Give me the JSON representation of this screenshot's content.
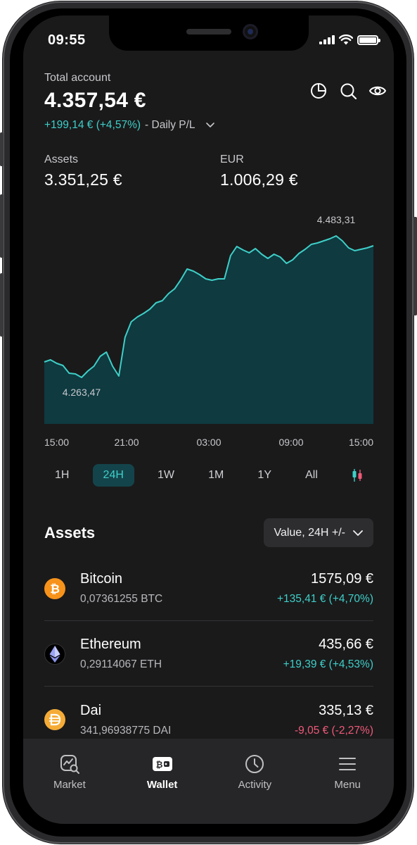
{
  "status_bar": {
    "time": "09:55"
  },
  "header": {
    "total_label": "Total account",
    "total_value": "4.357,54 €",
    "pl_change": "+199,14 € (+4,57%)",
    "pl_label": "- Daily P/L",
    "icons": [
      "pie-chart-icon",
      "search-icon",
      "eye-icon"
    ]
  },
  "balances": [
    {
      "label": "Assets",
      "value": "3.351,25 €"
    },
    {
      "label": "EUR",
      "value": "1.006,29 €"
    }
  ],
  "chart_data": {
    "type": "area",
    "title": "",
    "xlabel": "",
    "ylabel": "",
    "x_ticks": [
      "15:00",
      "21:00",
      "03:00",
      "09:00",
      "15:00"
    ],
    "high_label": "4.483,31",
    "low_label": "4.263,47",
    "ylim": [
      4210,
      4500
    ],
    "values": [
      4298,
      4301,
      4296,
      4293,
      4282,
      4281,
      4276,
      4285,
      4292,
      4306,
      4312,
      4292,
      4278,
      4333,
      4355,
      4362,
      4367,
      4373,
      4382,
      4385,
      4395,
      4402,
      4415,
      4430,
      4427,
      4422,
      4416,
      4414,
      4416,
      4416,
      4449,
      4462,
      4457,
      4453,
      4459,
      4451,
      4445,
      4451,
      4447,
      4438,
      4443,
      4452,
      4458,
      4465,
      4467,
      4470,
      4473,
      4477,
      4470,
      4460,
      4456,
      4458,
      4460,
      4463
    ],
    "grid": false,
    "legend": "none",
    "colors": {
      "line": "#3ecfc8",
      "fill": "#0e3a40"
    }
  },
  "timeframes": {
    "items": [
      "1H",
      "24H",
      "1W",
      "1M",
      "1Y",
      "All"
    ],
    "active": "24H"
  },
  "assets_section": {
    "title": "Assets",
    "sort_label": "Value, 24H +/-",
    "items": [
      {
        "name": "Bitcoin",
        "amount": "0,07361255 BTC",
        "value": "1575,09 €",
        "change": "+135,41 € (+4,70%)",
        "direction": "up",
        "icon": "bitcoin-icon",
        "color": "#f7931a"
      },
      {
        "name": "Ethereum",
        "amount": "0,29114067 ETH",
        "value": "435,66 €",
        "change": "+19,39 € (+4,53%)",
        "direction": "up",
        "icon": "ethereum-icon",
        "color": "#000000"
      },
      {
        "name": "Dai",
        "amount": "341,96938775 DAI",
        "value": "335,13 €",
        "change": "-9,05 € (-2,27%)",
        "direction": "down",
        "icon": "dai-icon",
        "color": "#f5ac37"
      }
    ]
  },
  "tabbar": {
    "items": [
      {
        "label": "Market",
        "icon": "market-icon"
      },
      {
        "label": "Wallet",
        "icon": "wallet-icon"
      },
      {
        "label": "Activity",
        "icon": "activity-icon"
      },
      {
        "label": "Menu",
        "icon": "menu-icon"
      }
    ],
    "active": "Wallet"
  }
}
